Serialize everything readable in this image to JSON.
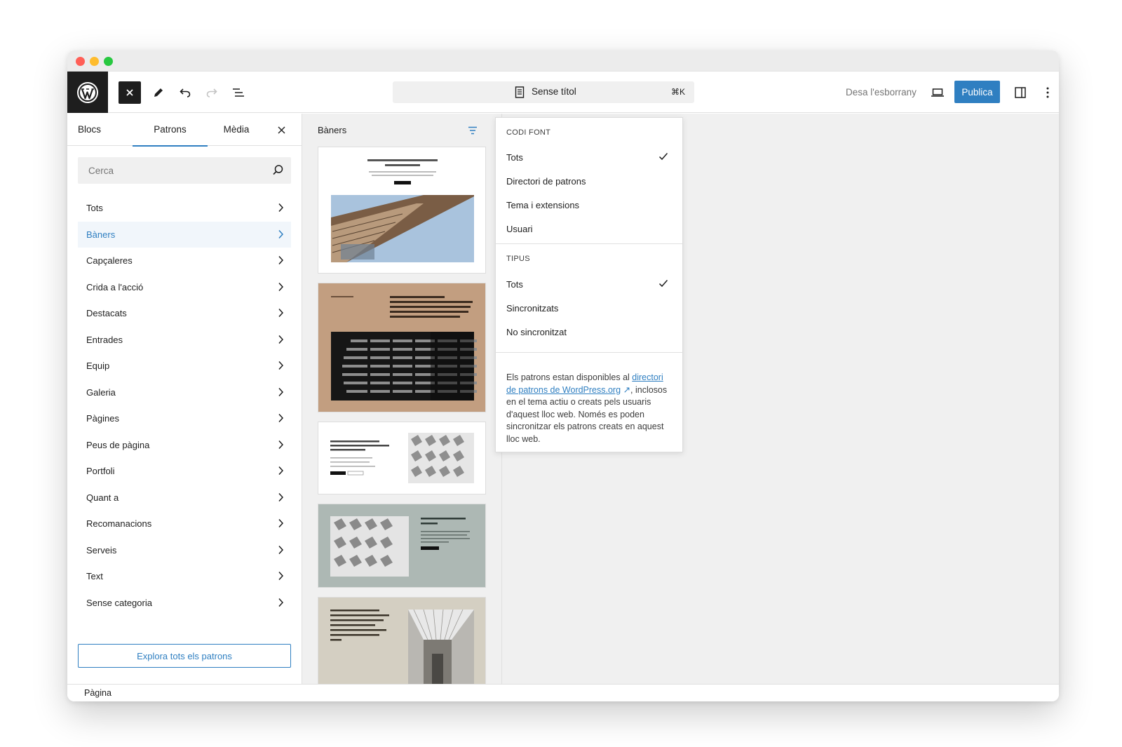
{
  "toolbar": {
    "document_title": "Sense títol",
    "shortcut": "⌘K",
    "save_draft": "Desa l'esborrany",
    "publish": "Publica"
  },
  "sidebar": {
    "tabs": [
      {
        "label": "Blocs"
      },
      {
        "label": "Patrons"
      },
      {
        "label": "Mèdia"
      }
    ],
    "active_tab": "Patrons",
    "search_placeholder": "Cerca",
    "categories": [
      {
        "label": "Tots"
      },
      {
        "label": "Bàners"
      },
      {
        "label": "Capçaleres"
      },
      {
        "label": "Crida a l'acció"
      },
      {
        "label": "Destacats"
      },
      {
        "label": "Entrades"
      },
      {
        "label": "Equip"
      },
      {
        "label": "Galeria"
      },
      {
        "label": "Pàgines"
      },
      {
        "label": "Peus de pàgina"
      },
      {
        "label": "Portfoli"
      },
      {
        "label": "Quant a"
      },
      {
        "label": "Recomanacions"
      },
      {
        "label": "Serveis"
      },
      {
        "label": "Text"
      },
      {
        "label": "Sense categoria"
      }
    ],
    "active_category": "Bàners",
    "explore_button": "Explora tots els patrons"
  },
  "patterns_panel": {
    "heading": "Bàners"
  },
  "filter_dropdown": {
    "source_heading": "CODI FONT",
    "source_options": [
      {
        "label": "Tots",
        "checked": true
      },
      {
        "label": "Directori de patrons",
        "checked": false
      },
      {
        "label": "Tema i extensions",
        "checked": false
      },
      {
        "label": "Usuari",
        "checked": false
      }
    ],
    "type_heading": "TIPUS",
    "type_options": [
      {
        "label": "Tots",
        "checked": true
      },
      {
        "label": "Sincronitzats",
        "checked": false
      },
      {
        "label": "No sincronitzat",
        "checked": false
      }
    ],
    "note_before": "Els patrons estan disponibles al ",
    "note_link": "directori de patrons de WordPress.org",
    "note_link_arrow": "↗",
    "note_after": ", inclosos en el tema actiu o creats pels usuaris d'aquest lloc web. Només es poden sincronitzar els patrons creats en aquest lloc web."
  },
  "statusbar": {
    "label": "Pàgina"
  },
  "colors": {
    "accent": "#2f7fc1",
    "dark": "#1e1e1e"
  }
}
